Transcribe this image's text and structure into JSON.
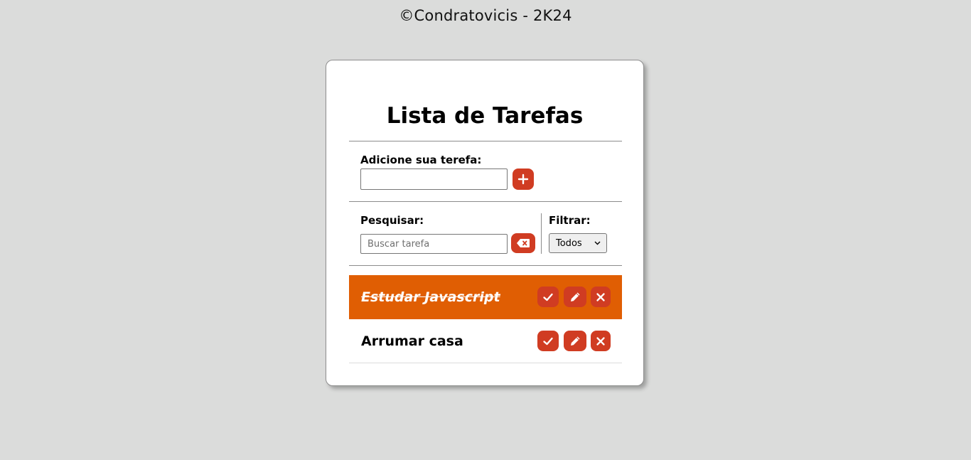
{
  "footer": {
    "credit": "©Condratovicis - 2K24"
  },
  "app": {
    "title": "Lista de Tarefas"
  },
  "add_form": {
    "label": "Adicione sua terefa:",
    "input_value": "",
    "input_placeholder": "",
    "add_button_icon": "plus-icon"
  },
  "search": {
    "label": "Pesquisar:",
    "placeholder": "Buscar tarefa",
    "value": "",
    "clear_button_icon": "backspace-icon"
  },
  "filter": {
    "label": "Filtrar:",
    "selected": "Todos"
  },
  "todos": [
    {
      "text": "Estudar Javascript",
      "done": true
    },
    {
      "text": "Arrumar casa",
      "done": false
    }
  ],
  "colors": {
    "page_background": "#dbdcdb",
    "accent_red": "#d03c22",
    "done_orange": "#e05e03",
    "card_background": "#ffffff"
  },
  "icons": {
    "finish": "check-icon",
    "edit": "pencil-icon",
    "remove": "x-icon"
  }
}
